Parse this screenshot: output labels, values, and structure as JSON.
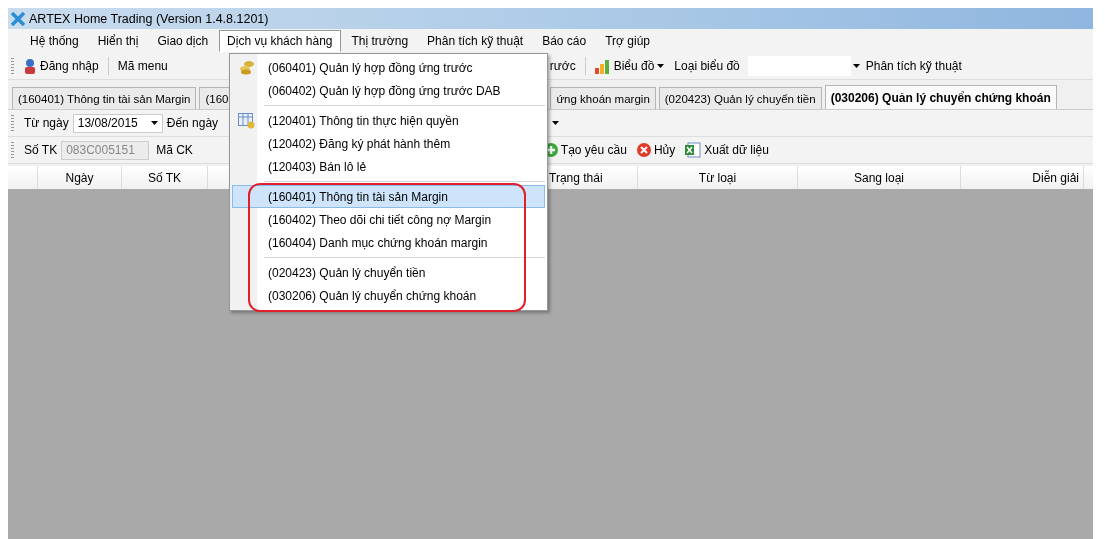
{
  "window": {
    "title": "ARTEX Home Trading (Version 1.4.8.1201)"
  },
  "menu_bar": [
    {
      "label": "Hệ thống",
      "selected": false
    },
    {
      "label": "Hiển thị",
      "selected": false
    },
    {
      "label": "Giao dịch",
      "selected": false
    },
    {
      "label": "Dịch vụ khách hàng",
      "selected": true
    },
    {
      "label": "Thị trường",
      "selected": false
    },
    {
      "label": "Phân tích kỹ thuật",
      "selected": false
    },
    {
      "label": "Báo cáo",
      "selected": false
    },
    {
      "label": "Trợ giúp",
      "selected": false
    }
  ],
  "toolbar": {
    "login": "Đăng nhập",
    "menu_code": "Mã menu",
    "partial": "rước",
    "chart": "Biểu đồ",
    "chart_type": "Loại biểu đồ",
    "analysis": "Phân tích kỹ thuật"
  },
  "tabs": [
    {
      "label": "(160401) Thông tin tài sản Margin",
      "selected": false
    },
    {
      "label": "(160",
      "selected": false
    },
    {
      "label": "ứng khoán margin",
      "selected": false
    },
    {
      "label": "(020423) Quản lý chuyển tiền",
      "selected": false
    },
    {
      "label": "(030206) Quản lý chuyển chứng khoán",
      "selected": true
    }
  ],
  "filter_bar": {
    "from_label": "Từ ngày",
    "from_value": "13/08/2015",
    "to_label": "Đến ngày"
  },
  "account_bar": {
    "account_label": "Số TK",
    "account_value": "083C005151",
    "account_disabled": true,
    "stock_label": "Mã CK",
    "actions": [
      "Tạo yêu cầu",
      "Hủy",
      "Xuất dữ liệu"
    ]
  },
  "table": {
    "columns": [
      "Ngày",
      "Số TK",
      "Trạng thái",
      "Từ loại",
      "Sang loại",
      "Diễn giải"
    ]
  },
  "dropdown_menu": {
    "groups": [
      [
        {
          "label": "(060401) Quản lý hợp đồng ứng trước",
          "selected": false
        },
        {
          "label": "(060402) Quản lý hợp đồng ứng trước DAB",
          "selected": false
        }
      ],
      [
        {
          "label": "(120401) Thông tin thực hiện quyền",
          "selected": false
        },
        {
          "label": "(120402) Đăng ký phát hành thêm",
          "selected": false
        },
        {
          "label": "(120403) Bán lô lẻ",
          "selected": false
        }
      ],
      [
        {
          "label": "(160401) Thông tin tài sản Margin",
          "selected": true
        },
        {
          "label": "(160402) Theo dõi chi tiết công nợ Margin",
          "selected": false
        },
        {
          "label": "(160404) Danh mục chứng khoán margin",
          "selected": false
        }
      ],
      [
        {
          "label": "(020423) Quản lý chuyển tiền",
          "selected": false
        },
        {
          "label": "(030206) Quản lý chuyển chứng khoán",
          "selected": false
        }
      ]
    ]
  }
}
